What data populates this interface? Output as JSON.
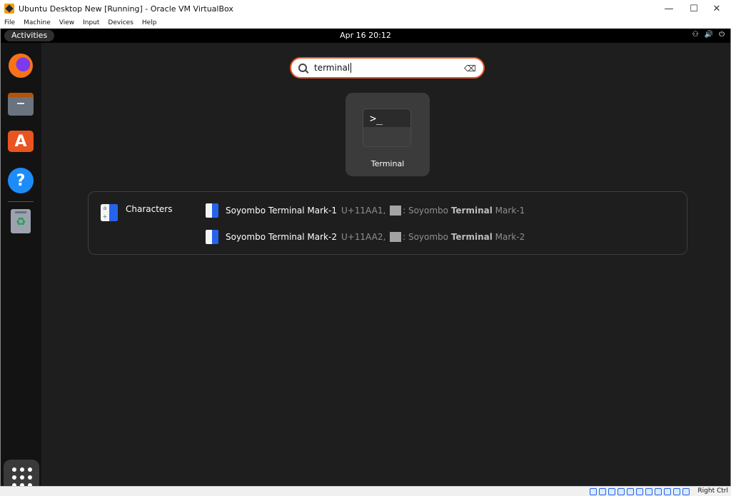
{
  "window": {
    "title": "Ubuntu Desktop New [Running] - Oracle VM VirtualBox",
    "minimize": "—",
    "maximize": "☐",
    "close": "✕"
  },
  "menubar": [
    "File",
    "Machine",
    "View",
    "Input",
    "Devices",
    "Help"
  ],
  "topbar": {
    "activities": "Activities",
    "clock": "Apr 16  20:12",
    "icons": [
      "network-icon",
      "volume-icon",
      "power-icon"
    ]
  },
  "dock": {
    "items": [
      "Firefox",
      "Files",
      "App Center",
      "Help",
      "Trash"
    ],
    "show_apps_icon": "app-grid-icon"
  },
  "search": {
    "value": "terminal"
  },
  "app_results": [
    {
      "name": "Terminal",
      "icon": ">_"
    }
  ],
  "characters": {
    "provider": "Characters",
    "rows": [
      {
        "title": "Soyombo Terminal Mark-1",
        "code": "U+11AA1,",
        "desc_prefix": ": Soyombo ",
        "desc_bold": "Terminal",
        "desc_suffix": " Mark-1"
      },
      {
        "title": "Soyombo Terminal Mark-2",
        "code": "U+11AA2,",
        "desc_prefix": ": Soyombo ",
        "desc_bold": "Terminal",
        "desc_suffix": " Mark-2"
      }
    ]
  },
  "statusbar": {
    "host_key": "Right Ctrl"
  }
}
